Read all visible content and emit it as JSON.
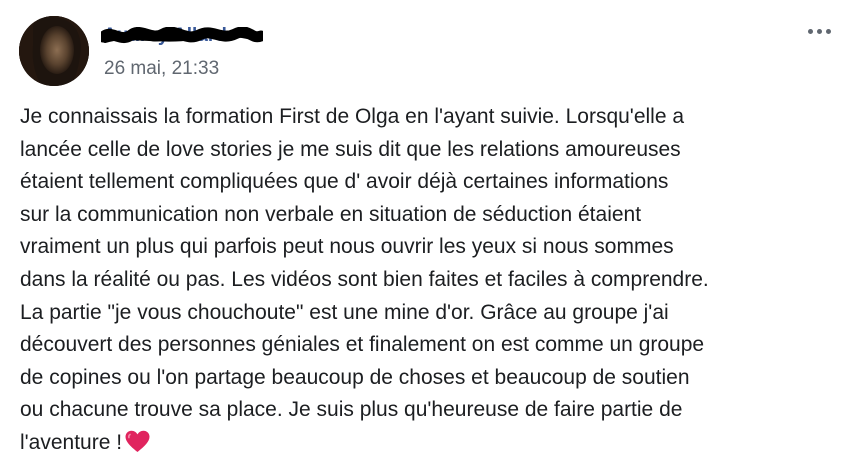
{
  "post": {
    "author": "Audrey Allard",
    "timestamp": "26 mai, 21:33",
    "text_lines": [
      "Je connaissais la formation First de Olga en l'ayant suivie. Lorsqu'elle a",
      "lancée celle de love stories je me suis dit que les relations amoureuses",
      "étaient tellement compliquées que d' avoir déjà certaines informations",
      "sur la communication non verbale en situation de séduction étaient",
      "vraiment un plus qui parfois peut nous ouvrir les yeux si nous sommes",
      "dans la réalité ou pas. Les vidéos sont bien faites et faciles à comprendre.",
      "La partie \"je vous chouchoute\" est une mine d'or. Grâce au groupe j'ai",
      "découvert des personnes géniales et finalement on est comme un groupe",
      "de copines ou l'on partage beaucoup de choses et beaucoup de soutien",
      "ou chacune trouve sa place. Je suis plus qu'heureuse de faire partie de",
      "l'aventure !"
    ],
    "emoji": "heart-icon",
    "more_icon": "more-options-icon"
  },
  "colors": {
    "author": "#385898",
    "timestamp": "#606770",
    "text": "#1c1e21",
    "heart": "#e0245e"
  }
}
